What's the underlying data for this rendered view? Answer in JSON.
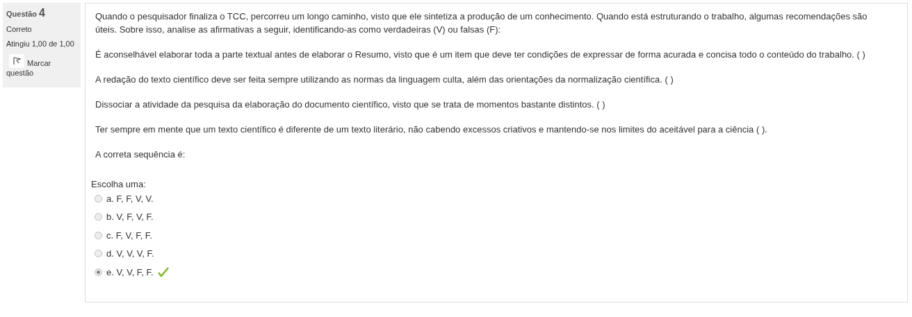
{
  "info": {
    "label": "Questão",
    "number": "4",
    "status": "Correto",
    "grade": "Atingiu 1,00 de 1,00",
    "flag": "Marcar questão"
  },
  "paragraphs": [
    "Quando o pesquisador finaliza o TCC, percorreu um longo caminho, visto que ele sintetiza a produção de um conhecimento. Quando está estruturando o trabalho, algumas recomendações são úteis. Sobre isso, analise as afirmativas a seguir, identificando-as como verdadeiras (V) ou falsas (F):",
    "É aconselhável elaborar toda a parte textual antes de elaborar o Resumo, visto que é um item que deve ter condições de expressar de forma acurada e concisa todo o conteúdo do trabalho. ( )",
    "A redação do texto científico deve ser feita sempre utilizando as normas da linguagem culta, além das orientações da normalização científica. ( )",
    "Dissociar a atividade da pesquisa da elaboração do documento científico, visto que se trata de momentos bastante distintos. ( )",
    "Ter sempre em mente que um texto científico é diferente de um texto literário, não cabendo excessos criativos e mantendo-se nos limites do aceitável para a ciência ( ).",
    "A correta sequência é:"
  ],
  "prompt": "Escolha uma:",
  "options": [
    {
      "label": "a. F, F, V, V.",
      "selected": false,
      "correct": false
    },
    {
      "label": "b. V, F, V, F.",
      "selected": false,
      "correct": false
    },
    {
      "label": "c. F, V, F, F.",
      "selected": false,
      "correct": false
    },
    {
      "label": "d. V, V, V, F.",
      "selected": false,
      "correct": false
    },
    {
      "label": "e. V, V, F, F.",
      "selected": true,
      "correct": true
    }
  ]
}
